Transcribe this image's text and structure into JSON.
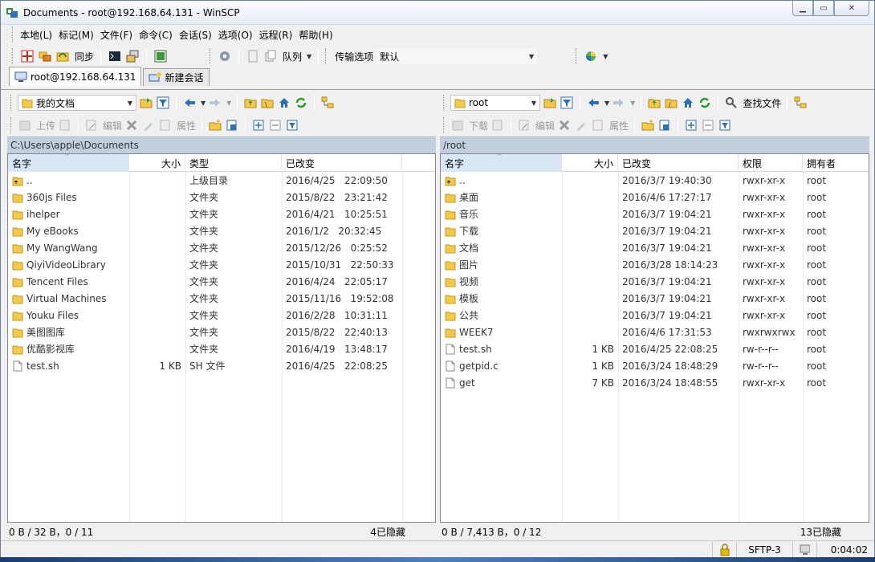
{
  "window": {
    "title": "Documents - root@192.168.64.131 - WinSCP"
  },
  "menu": [
    "本地(L)",
    "标记(M)",
    "文件(F)",
    "命令(C)",
    "会话(S)",
    "选项(O)",
    "远程(R)",
    "帮助(H)"
  ],
  "toolbar": {
    "sync": "同步",
    "queue": "队列",
    "transfer_label": "传输选项",
    "transfer_value": "默认"
  },
  "tabs": {
    "active": "root@192.168.64.131",
    "new": "新建会话"
  },
  "local": {
    "location": "我的文档",
    "actions": {
      "upload": "上传",
      "edit": "编辑",
      "props": "属性"
    },
    "path": "C:\\Users\\apple\\Documents",
    "headers": {
      "name": "名字",
      "size": "大小",
      "type": "类型",
      "changed": "已改变"
    },
    "rows": [
      {
        "name": "..",
        "size": "",
        "type": "上级目录",
        "changed": "2016/4/25   22:09:50",
        "kind": "up"
      },
      {
        "name": "360js Files",
        "size": "",
        "type": "文件夹",
        "changed": "2015/8/22   23:21:42",
        "kind": "folder"
      },
      {
        "name": "ihelper",
        "size": "",
        "type": "文件夹",
        "changed": "2016/4/21   10:25:51",
        "kind": "folder"
      },
      {
        "name": "My eBooks",
        "size": "",
        "type": "文件夹",
        "changed": "2016/1/2   20:32:45",
        "kind": "folder"
      },
      {
        "name": "My WangWang",
        "size": "",
        "type": "文件夹",
        "changed": "2015/12/26   0:25:52",
        "kind": "folder"
      },
      {
        "name": "QiyiVideoLibrary",
        "size": "",
        "type": "文件夹",
        "changed": "2015/10/31   22:50:33",
        "kind": "folder"
      },
      {
        "name": "Tencent Files",
        "size": "",
        "type": "文件夹",
        "changed": "2016/4/24   22:05:17",
        "kind": "folder"
      },
      {
        "name": "Virtual Machines",
        "size": "",
        "type": "文件夹",
        "changed": "2015/11/16   19:52:08",
        "kind": "folder"
      },
      {
        "name": "Youku Files",
        "size": "",
        "type": "文件夹",
        "changed": "2016/2/28   10:31:11",
        "kind": "folder"
      },
      {
        "name": "美图图库",
        "size": "",
        "type": "文件夹",
        "changed": "2015/8/22   22:40:13",
        "kind": "folder"
      },
      {
        "name": "优酷影视库",
        "size": "",
        "type": "文件夹",
        "changed": "2016/4/19   13:48:17",
        "kind": "folder"
      },
      {
        "name": "test.sh",
        "size": "1 KB",
        "type": "SH 文件",
        "changed": "2016/4/25   22:08:25",
        "kind": "file"
      }
    ],
    "status_left": "0 B / 32 B，0 / 11",
    "status_right": "4已隐藏"
  },
  "remote": {
    "location": "root",
    "find_files": "查找文件",
    "actions": {
      "download": "下载",
      "edit": "编辑",
      "props": "属性"
    },
    "path": "/root",
    "headers": {
      "name": "名字",
      "size": "大小",
      "changed": "已改变",
      "rights": "权限",
      "owner": "拥有者"
    },
    "rows": [
      {
        "name": "..",
        "size": "",
        "changed": "2016/3/7 19:40:30",
        "rights": "rwxr-xr-x",
        "owner": "root",
        "kind": "up"
      },
      {
        "name": "桌面",
        "size": "",
        "changed": "2016/4/6 17:27:17",
        "rights": "rwxr-xr-x",
        "owner": "root",
        "kind": "folder"
      },
      {
        "name": "音乐",
        "size": "",
        "changed": "2016/3/7 19:04:21",
        "rights": "rwxr-xr-x",
        "owner": "root",
        "kind": "folder"
      },
      {
        "name": "下载",
        "size": "",
        "changed": "2016/3/7 19:04:21",
        "rights": "rwxr-xr-x",
        "owner": "root",
        "kind": "folder"
      },
      {
        "name": "文档",
        "size": "",
        "changed": "2016/3/7 19:04:21",
        "rights": "rwxr-xr-x",
        "owner": "root",
        "kind": "folder"
      },
      {
        "name": "图片",
        "size": "",
        "changed": "2016/3/28 18:14:23",
        "rights": "rwxr-xr-x",
        "owner": "root",
        "kind": "folder"
      },
      {
        "name": "视频",
        "size": "",
        "changed": "2016/3/7 19:04:21",
        "rights": "rwxr-xr-x",
        "owner": "root",
        "kind": "folder"
      },
      {
        "name": "模板",
        "size": "",
        "changed": "2016/3/7 19:04:21",
        "rights": "rwxr-xr-x",
        "owner": "root",
        "kind": "folder"
      },
      {
        "name": "公共",
        "size": "",
        "changed": "2016/3/7 19:04:21",
        "rights": "rwxr-xr-x",
        "owner": "root",
        "kind": "folder"
      },
      {
        "name": "WEEK7",
        "size": "",
        "changed": "2016/4/6 17:31:53",
        "rights": "rwxrwxrwx",
        "owner": "root",
        "kind": "folder"
      },
      {
        "name": "test.sh",
        "size": "1 KB",
        "changed": "2016/4/25 22:08:25",
        "rights": "rw-r--r--",
        "owner": "root",
        "kind": "file"
      },
      {
        "name": "getpid.c",
        "size": "1 KB",
        "changed": "2016/3/24 18:48:29",
        "rights": "rw-r--r--",
        "owner": "root",
        "kind": "file"
      },
      {
        "name": "get",
        "size": "7 KB",
        "changed": "2016/3/24 18:48:55",
        "rights": "rwxr-xr-x",
        "owner": "root",
        "kind": "file"
      }
    ],
    "status_left": "0 B / 7,413 B，0 / 12",
    "status_right": "13已隐藏"
  },
  "bottom": {
    "protocol": "SFTP-3",
    "elapsed": "0:04:02"
  },
  "colors": {
    "folder": "#f2c94c",
    "pathbar": "#c2cfdf",
    "accent": "#2f6fb5"
  }
}
